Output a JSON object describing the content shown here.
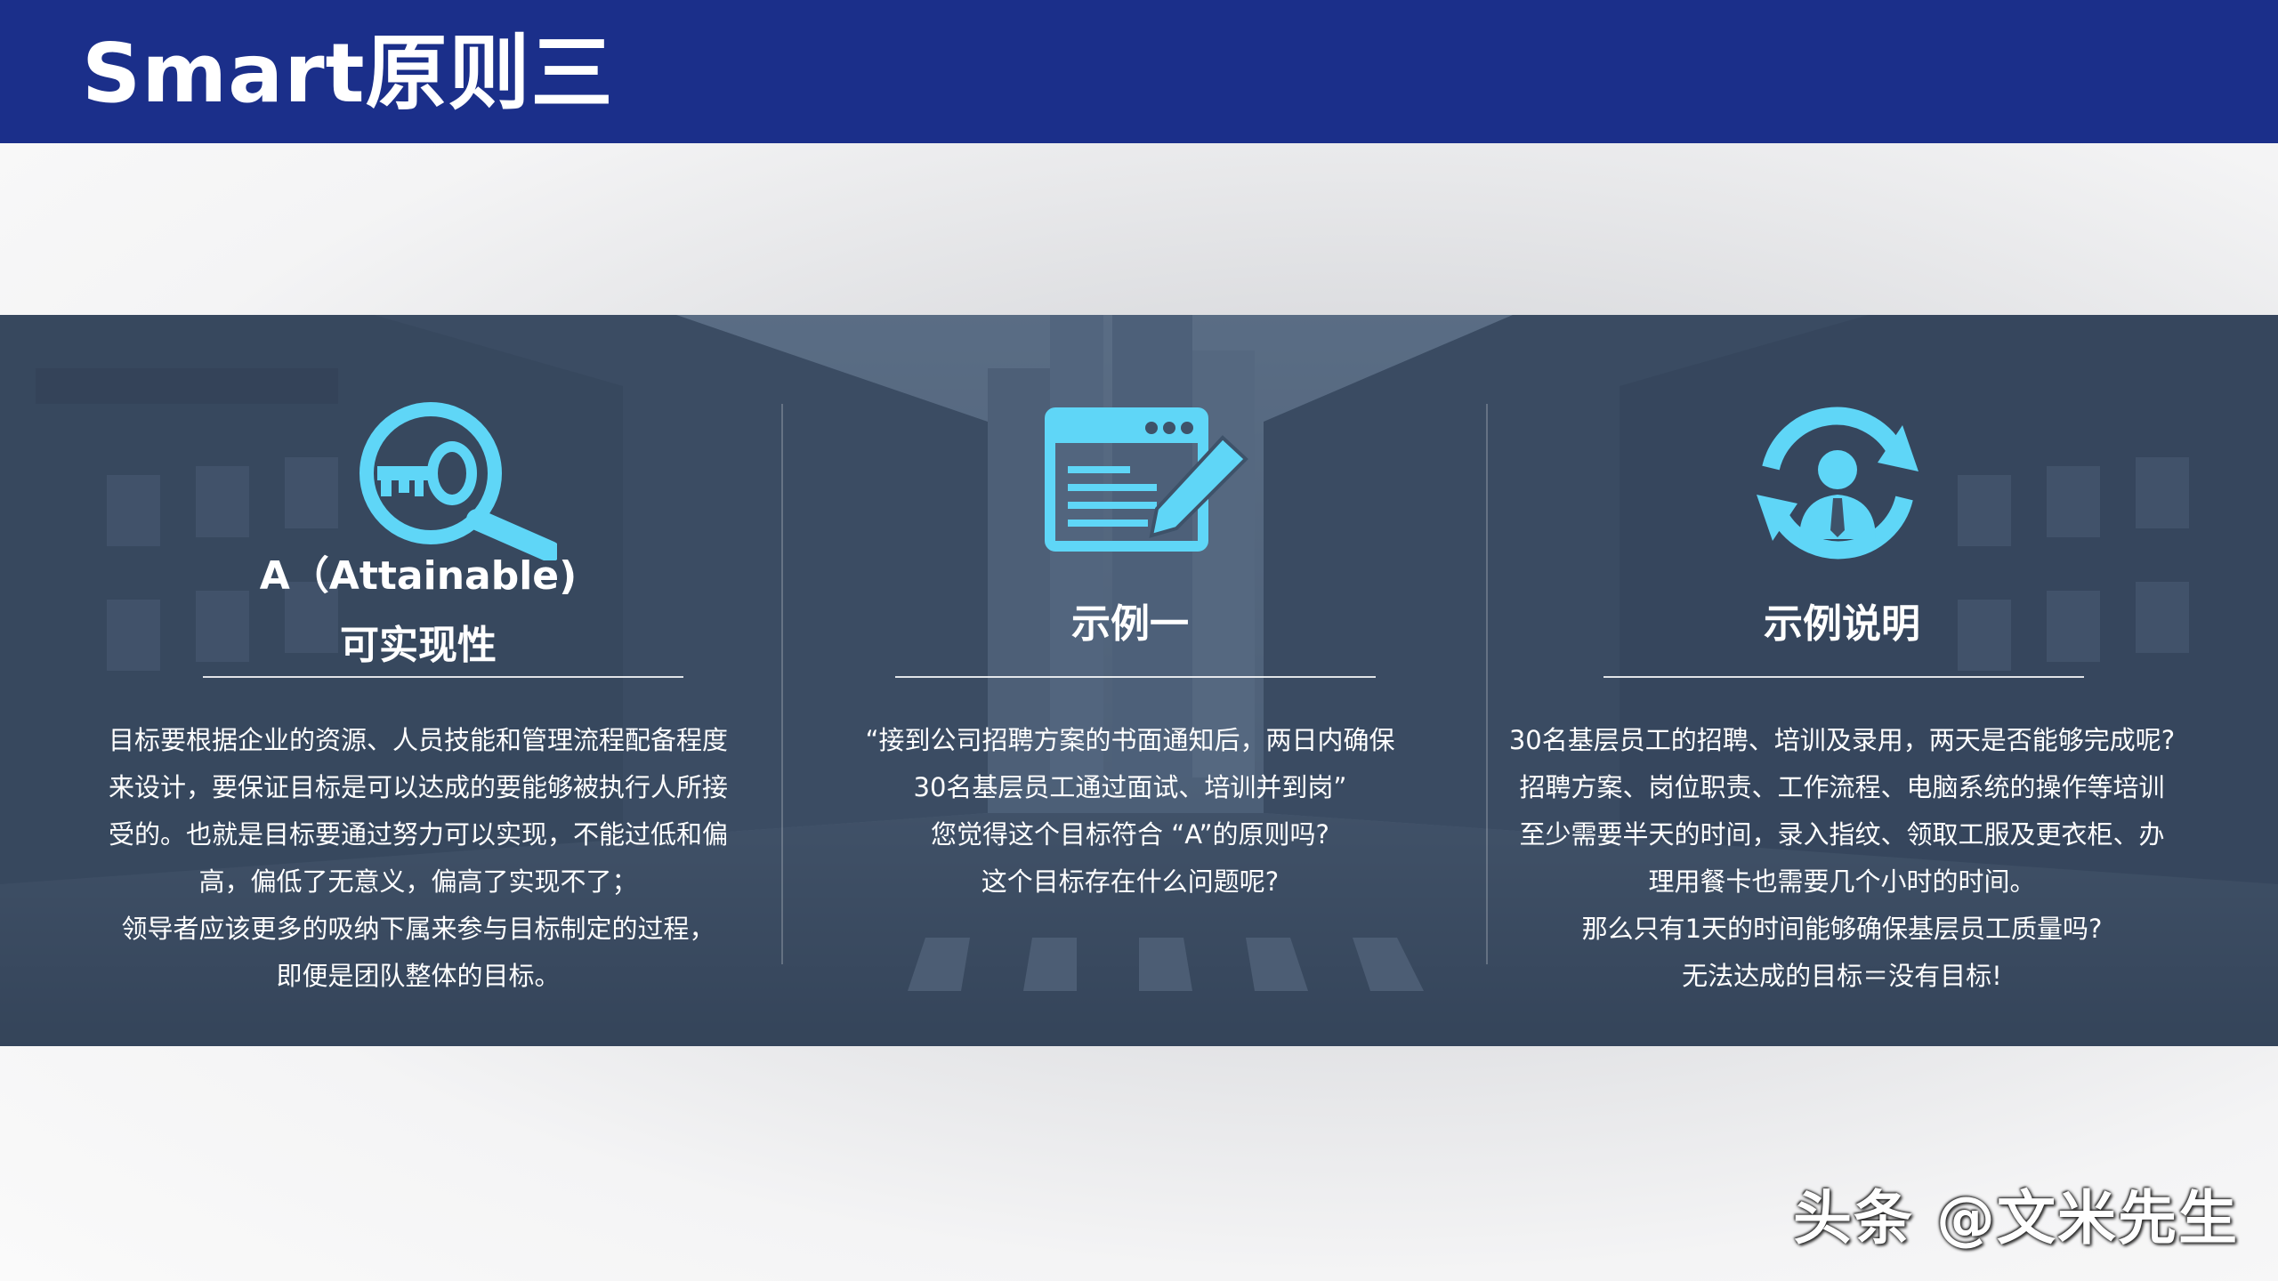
{
  "header": {
    "title": "Smart原则三"
  },
  "columns": [
    {
      "icon": "key-magnifier-icon",
      "title_line1": "A（Attainable)",
      "title_line2": "可实现性",
      "lines": [
        "目标要根据企业的资源、人员技能和管理流程配备程度",
        "来设计，要保证目标是可以达成的要能够被执行人所接",
        "受的。也就是目标要通过努力可以实现，不能过低和偏",
        "高，偏低了无意义，偏高了实现不了；",
        "领导者应该更多的吸纳下属来参与目标制定的过程，",
        "即便是团队整体的目标。"
      ]
    },
    {
      "icon": "document-edit-icon",
      "title": "示例一",
      "lines": [
        "“接到公司招聘方案的书面通知后，两日内确保",
        "30名基层员工通过面试、培训并到岗”",
        "您觉得这个目标符合 “A”的原则吗?",
        "这个目标存在什么问题呢?"
      ]
    },
    {
      "icon": "person-cycle-icon",
      "title": "示例说明",
      "lines": [
        "30名基层员工的招聘、培训及录用，两天是否能够完成呢?",
        "招聘方案、岗位职责、工作流程、电脑系统的操作等培训",
        "至少需要半天的时间，录入指纹、领取工服及更衣柜、办",
        "理用餐卡也需要几个小时的时间。",
        "那么只有1天的时间能够确保基层员工质量吗?",
        "无法达成的目标＝没有目标!"
      ]
    }
  ],
  "watermark": "头条 @文米先生",
  "colors": {
    "header": "#1b2f8a",
    "icon": "#5fd6f7",
    "overlay": "#3a4e68"
  }
}
